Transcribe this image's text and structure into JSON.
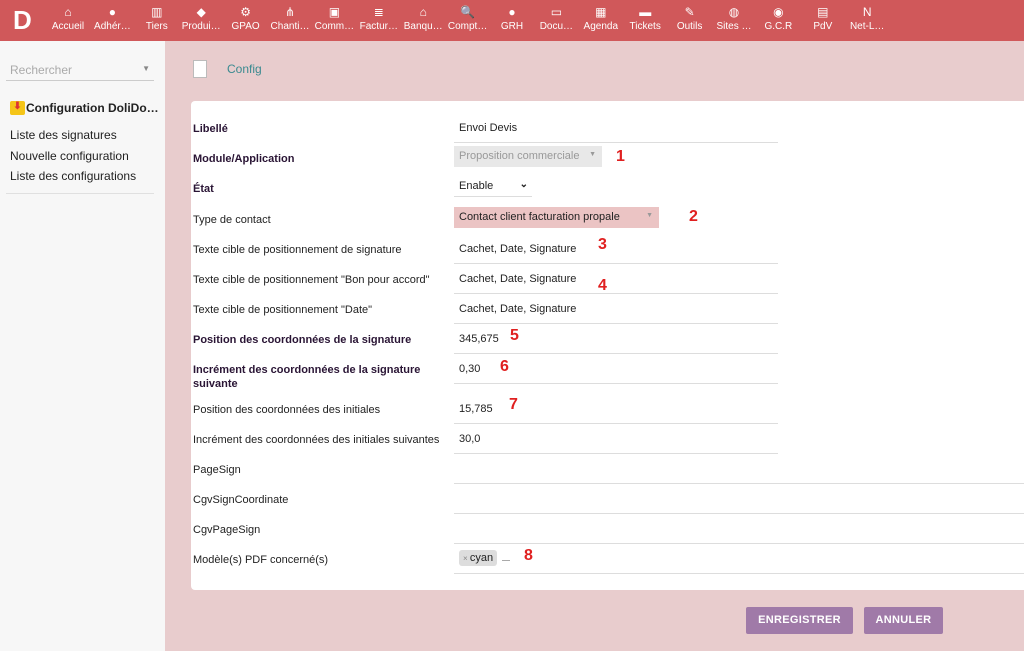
{
  "nav": [
    {
      "label": "Accueil",
      "icon": "⌂"
    },
    {
      "label": "Adhér…",
      "icon": "●"
    },
    {
      "label": "Tiers",
      "icon": "▥"
    },
    {
      "label": "Produi…",
      "icon": "◆"
    },
    {
      "label": "GPAO",
      "icon": "⚙"
    },
    {
      "label": "Chanti…",
      "icon": "⋔"
    },
    {
      "label": "Comm…",
      "icon": "▣"
    },
    {
      "label": "Factur…",
      "icon": "≣"
    },
    {
      "label": "Banqu…",
      "icon": "⌂"
    },
    {
      "label": "Compt…",
      "icon": "🔍"
    },
    {
      "label": "GRH",
      "icon": "●"
    },
    {
      "label": "Docu…",
      "icon": "▭"
    },
    {
      "label": "Agenda",
      "icon": "▦"
    },
    {
      "label": "Tickets",
      "icon": "▬"
    },
    {
      "label": "Outils",
      "icon": "✎"
    },
    {
      "label": "Sites …",
      "icon": "◍"
    },
    {
      "label": "G.C.R",
      "icon": "◉"
    },
    {
      "label": "PdV",
      "icon": "▤"
    },
    {
      "label": "Net-L…",
      "icon": "N"
    }
  ],
  "sidebar": {
    "search_placeholder": "Rechercher",
    "title": "Configuration DoliDo…",
    "items": [
      "Liste des signatures",
      "Nouvelle configuration",
      "Liste des configurations"
    ]
  },
  "breadcrumb": "Config",
  "form": [
    {
      "label": "Libellé",
      "value": "Envoi Devis",
      "bold": true
    },
    {
      "label": "Module/Application",
      "value": "Proposition commerciale",
      "bold": true
    },
    {
      "label": "État",
      "value": "Enable",
      "bold": true
    },
    {
      "label": "Type de contact",
      "value": "Contact client facturation propale"
    },
    {
      "label": "Texte cible de positionnement de signature",
      "value": "Cachet, Date, Signature"
    },
    {
      "label": "Texte cible de positionnement \"Bon pour accord\"",
      "value": "Cachet, Date, Signature"
    },
    {
      "label": "Texte cible de positionnement \"Date\"",
      "value": "Cachet, Date, Signature"
    },
    {
      "label": "Position des coordonnées de la signature",
      "value": "345,675",
      "bold": true
    },
    {
      "label": "Incrément des coordonnées de la signature suivante",
      "value": "0,30",
      "bold": true
    },
    {
      "label": "Position des coordonnées des initiales",
      "value": "15,785"
    },
    {
      "label": "Incrément des coordonnées des initiales suivantes",
      "value": "30,0"
    },
    {
      "label": "PageSign",
      "value": ""
    },
    {
      "label": "CgvSignCoordinate",
      "value": ""
    },
    {
      "label": "CgvPageSign",
      "value": ""
    },
    {
      "label": "Modèle(s) PDF concerné(s)",
      "value": "cyan"
    }
  ],
  "annotations": [
    "1",
    "2",
    "3",
    "4",
    "5",
    "6",
    "7",
    "8"
  ],
  "buttons": {
    "save": "ENREGISTRER",
    "cancel": "ANNULER"
  },
  "colors": {
    "topbar": "#d0585a",
    "button": "#a07aa8",
    "annotation": "#e02020"
  }
}
